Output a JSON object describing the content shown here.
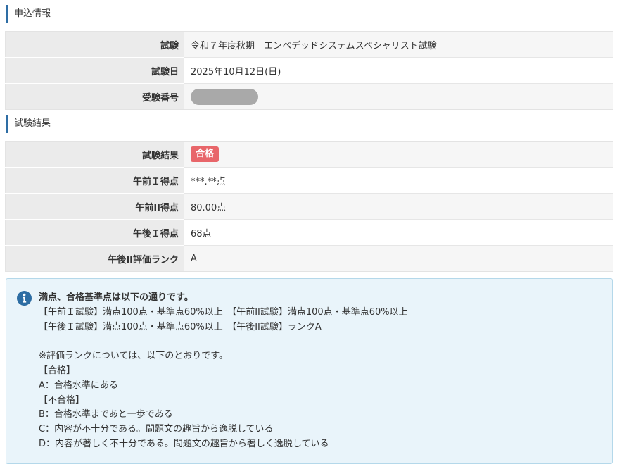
{
  "application_section": {
    "heading": "申込情報",
    "rows": [
      {
        "label": "試験",
        "value": "令和７年度秋期　エンベデッドシステムスペシャリスト試験"
      },
      {
        "label": "試験日",
        "value": "2025年10月12日(日)"
      },
      {
        "label": "受験番号",
        "value": ""
      }
    ]
  },
  "result_section": {
    "heading": "試験結果",
    "result_label": "試験結果",
    "result_badge": "合格",
    "badge_color": "#e8666a",
    "rows": [
      {
        "label": "午前Ｉ得点",
        "value": "***.**点"
      },
      {
        "label": "午前II得点",
        "value": "80.00点"
      },
      {
        "label": "午後Ｉ得点",
        "value": "68点"
      },
      {
        "label": "午後II評価ランク",
        "value": "A"
      }
    ]
  },
  "info_box": {
    "icon": "info-circle-icon",
    "title": "満点、合格基準点は以下の通りです。",
    "lines": [
      "【午前Ｉ試験】満点100点・基準点60%以上　【午前II試験】満点100点・基準点60%以上",
      "【午後Ｉ試験】満点100点・基準点60%以上　【午後II試験】ランクA",
      "",
      "※評価ランクについては、以下のとおりです。",
      "【合格】",
      "A：合格水準にある",
      "【不合格】",
      "B：合格水準まであと一歩である",
      "C：内容が不十分である。問題文の趣旨から逸脱している",
      "D：内容が著しく不十分である。問題文の趣旨から著しく逸脱している"
    ]
  },
  "colors": {
    "accent": "#2e6da4",
    "label_bg": "#ebebeb",
    "info_bg": "#e9f4fa",
    "info_icon": "#2d6da3"
  }
}
